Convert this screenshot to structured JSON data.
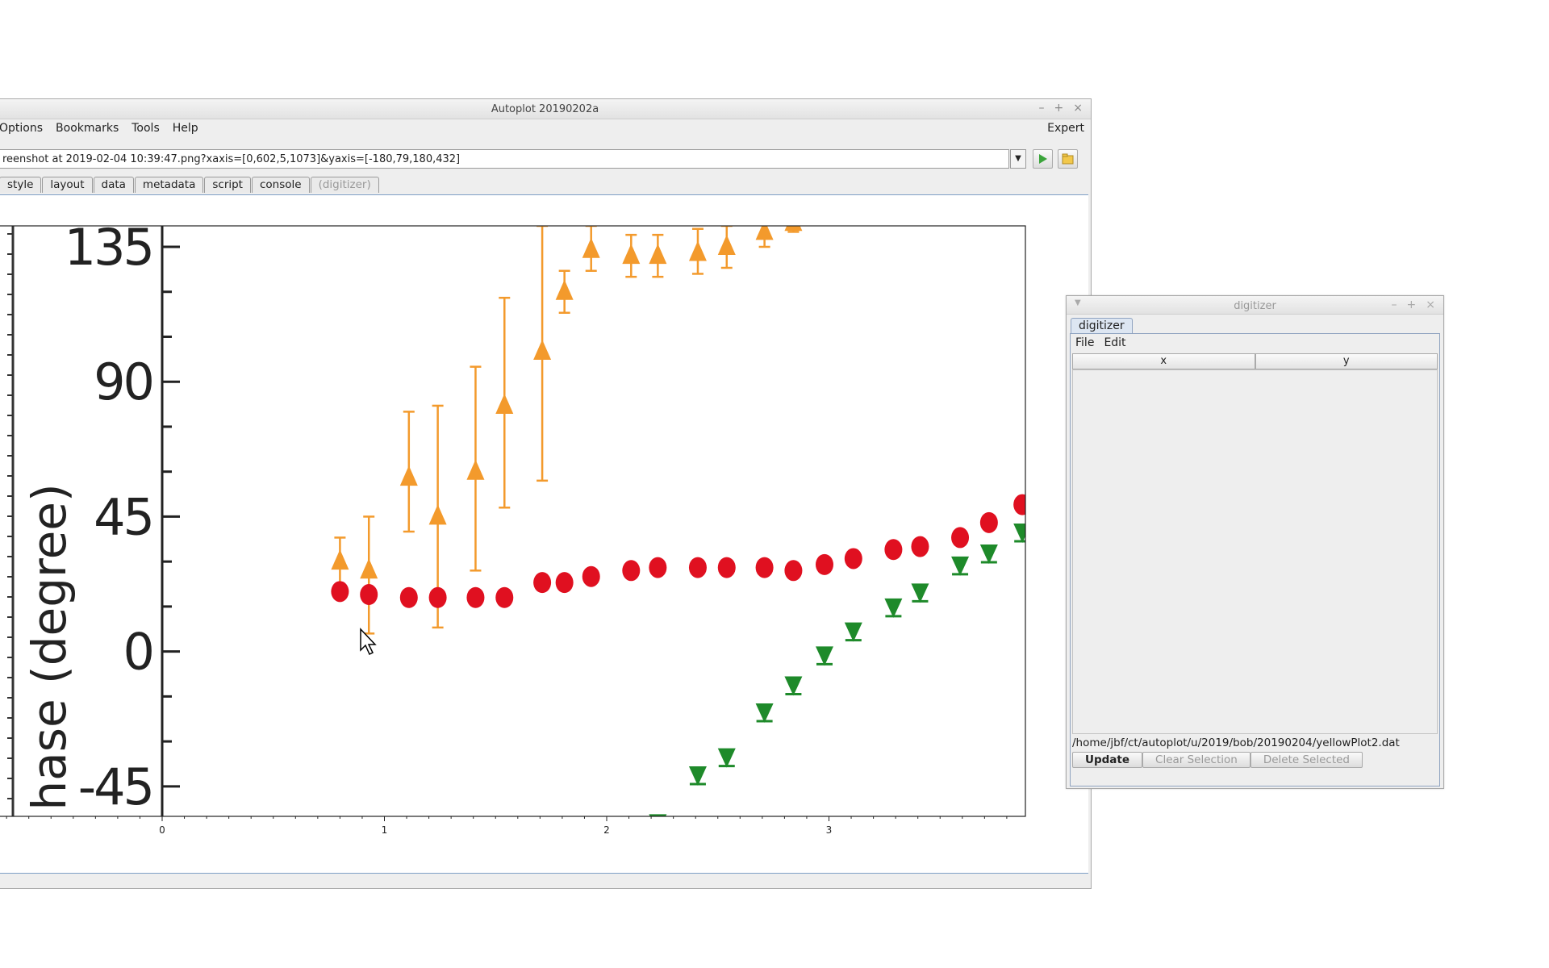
{
  "main_window": {
    "title": "Autoplot 20190202a",
    "menu": [
      "Options",
      "Bookmarks",
      "Tools",
      "Help"
    ],
    "expert_label": "Expert",
    "url": "reenshot at 2019-02-04 10:39:47.png?xaxis=[0,602,5,1073]&yaxis=[-180,79,180,432]",
    "tabs": [
      "style",
      "layout",
      "data",
      "metadata",
      "script",
      "console",
      "(digitizer)"
    ],
    "window_buttons": [
      "–",
      "+",
      "×"
    ],
    "dropdown_icon": "▼"
  },
  "chart_data": {
    "type": "scatter",
    "x_ticks": [
      "0",
      "1",
      "2",
      "3"
    ],
    "xlim": [
      -0.7,
      3.87
    ],
    "ylim": [
      -55,
      142
    ],
    "image_y_tick_labels": [
      "135",
      "90",
      "45",
      "0",
      "-45"
    ],
    "image_y_label": "hase (degree)",
    "series": [
      {
        "marker": "triangle-up",
        "color": "#f39a2c",
        "points": [
          {
            "x": 0.8,
            "y": 30,
            "lo": 22,
            "hi": 38
          },
          {
            "x": 0.93,
            "y": 27,
            "lo": 6,
            "hi": 45
          },
          {
            "x": 1.11,
            "y": 58,
            "lo": 40,
            "hi": 80
          },
          {
            "x": 1.24,
            "y": 45,
            "lo": 8,
            "hi": 82
          },
          {
            "x": 1.41,
            "y": 60,
            "lo": 27,
            "hi": 95
          },
          {
            "x": 1.54,
            "y": 82,
            "lo": 48,
            "hi": 118
          },
          {
            "x": 1.71,
            "y": 100,
            "lo": 57,
            "hi": 142
          },
          {
            "x": 1.81,
            "y": 120,
            "lo": 113,
            "hi": 127
          },
          {
            "x": 1.93,
            "y": 134,
            "lo": 127,
            "hi": 142
          },
          {
            "x": 2.11,
            "y": 132,
            "lo": 125,
            "hi": 139
          },
          {
            "x": 2.23,
            "y": 132,
            "lo": 125,
            "hi": 139
          },
          {
            "x": 2.41,
            "y": 133,
            "lo": 126,
            "hi": 141
          },
          {
            "x": 2.54,
            "y": 135,
            "lo": 128,
            "hi": 142
          },
          {
            "x": 2.71,
            "y": 140,
            "lo": 135,
            "hi": 145
          },
          {
            "x": 2.84,
            "y": 143,
            "lo": 140,
            "hi": 146
          }
        ]
      },
      {
        "marker": "circle",
        "color": "#e01020",
        "points": [
          {
            "x": 0.8,
            "y": 20
          },
          {
            "x": 0.93,
            "y": 19
          },
          {
            "x": 1.11,
            "y": 18
          },
          {
            "x": 1.24,
            "y": 18
          },
          {
            "x": 1.41,
            "y": 18
          },
          {
            "x": 1.54,
            "y": 18
          },
          {
            "x": 1.71,
            "y": 23
          },
          {
            "x": 1.81,
            "y": 23
          },
          {
            "x": 1.93,
            "y": 25
          },
          {
            "x": 2.11,
            "y": 27
          },
          {
            "x": 2.23,
            "y": 28
          },
          {
            "x": 2.41,
            "y": 28
          },
          {
            "x": 2.54,
            "y": 28
          },
          {
            "x": 2.71,
            "y": 28
          },
          {
            "x": 2.84,
            "y": 27
          },
          {
            "x": 2.98,
            "y": 29
          },
          {
            "x": 3.11,
            "y": 31
          },
          {
            "x": 3.29,
            "y": 34
          },
          {
            "x": 3.41,
            "y": 35
          },
          {
            "x": 3.59,
            "y": 38
          },
          {
            "x": 3.72,
            "y": 43
          },
          {
            "x": 3.87,
            "y": 49
          }
        ]
      },
      {
        "marker": "triangle-down",
        "color": "#1e8a2a",
        "points": [
          {
            "x": 2.23,
            "y": -57
          },
          {
            "x": 2.41,
            "y": -41
          },
          {
            "x": 2.54,
            "y": -35
          },
          {
            "x": 2.71,
            "y": -20
          },
          {
            "x": 2.84,
            "y": -11
          },
          {
            "x": 2.98,
            "y": -1
          },
          {
            "x": 3.11,
            "y": 7
          },
          {
            "x": 3.29,
            "y": 15
          },
          {
            "x": 3.41,
            "y": 20
          },
          {
            "x": 3.59,
            "y": 29
          },
          {
            "x": 3.72,
            "y": 33
          },
          {
            "x": 3.87,
            "y": 40
          }
        ]
      }
    ]
  },
  "digitizer": {
    "title": "digitizer",
    "tab": "digitizer",
    "menu": [
      "File",
      "Edit"
    ],
    "columns": [
      "x",
      "y"
    ],
    "file_path": "/home/jbf/ct/autoplot/u/2019/bob/20190204/yellowPlot2.dat",
    "buttons": {
      "update": "Update",
      "clear": "Clear Selection",
      "delete": "Delete Selected"
    },
    "window_buttons": [
      "–",
      "+",
      "×"
    ]
  }
}
